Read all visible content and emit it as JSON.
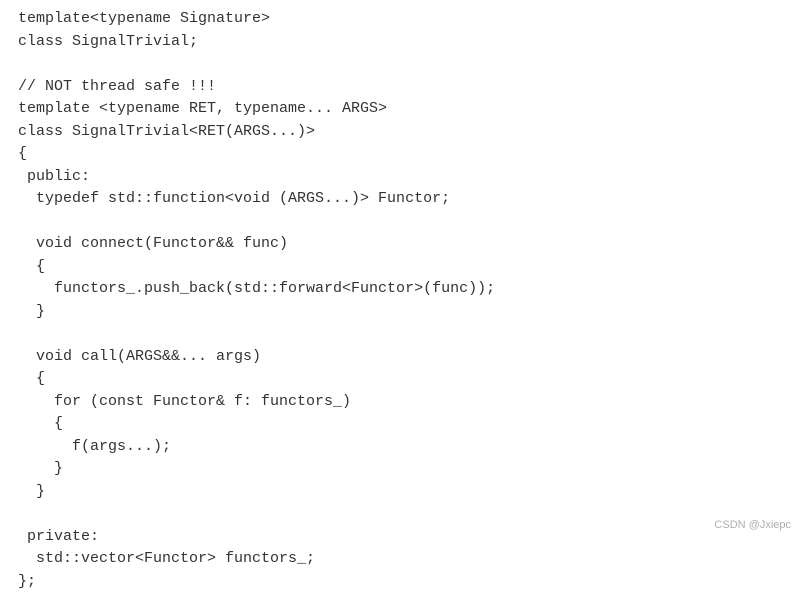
{
  "code": {
    "lines": [
      "template<typename Signature>",
      "class SignalTrivial;",
      "",
      "// NOT thread safe !!!",
      "template <typename RET, typename... ARGS>",
      "class SignalTrivial<RET(ARGS...)>",
      "{",
      " public:",
      "  typedef std::function<void (ARGS...)> Functor;",
      "",
      "  void connect(Functor&& func)",
      "  {",
      "    functors_.push_back(std::forward<Functor>(func));",
      "  }",
      "",
      "  void call(ARGS&&... args)",
      "  {",
      "    for (const Functor& f: functors_)",
      "    {",
      "      f(args...);",
      "    }",
      "  }",
      "",
      " private:",
      "  std::vector<Functor> functors_;",
      "};"
    ]
  },
  "watermark": "CSDN @Jxiepc"
}
